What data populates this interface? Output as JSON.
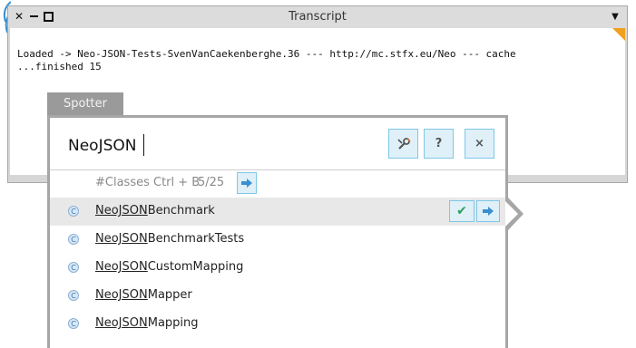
{
  "transcript": {
    "title": "Transcript",
    "lines": [
      "Loaded -> Neo-JSON-Tests-SvenVanCaekenberghe.36 --- http://mc.stfx.eu/Neo --- cache",
      "...finished 15"
    ],
    "accent_color": "#f0a020"
  },
  "spotter": {
    "tab_label": "Spotter",
    "query": "NeoJSON",
    "buttons": {
      "help": "?",
      "close": "×"
    },
    "category": {
      "label": "#Classes Ctrl + B",
      "count": "5/25"
    },
    "results": [
      {
        "match": "NeoJSON",
        "rest": "Benchmark",
        "icon": "C",
        "selected": true
      },
      {
        "match": "NeoJSON",
        "rest": "BenchmarkTests",
        "icon": "C",
        "selected": false
      },
      {
        "match": "NeoJSON",
        "rest": "CustomMapping",
        "icon": "C",
        "selected": false
      },
      {
        "match": "NeoJSON",
        "rest": "Mapper",
        "icon": "C",
        "selected": false
      },
      {
        "match": "NeoJSON",
        "rest": "Mapping",
        "icon": "C",
        "selected": false
      }
    ],
    "accent_color": "#7fc7e6"
  }
}
